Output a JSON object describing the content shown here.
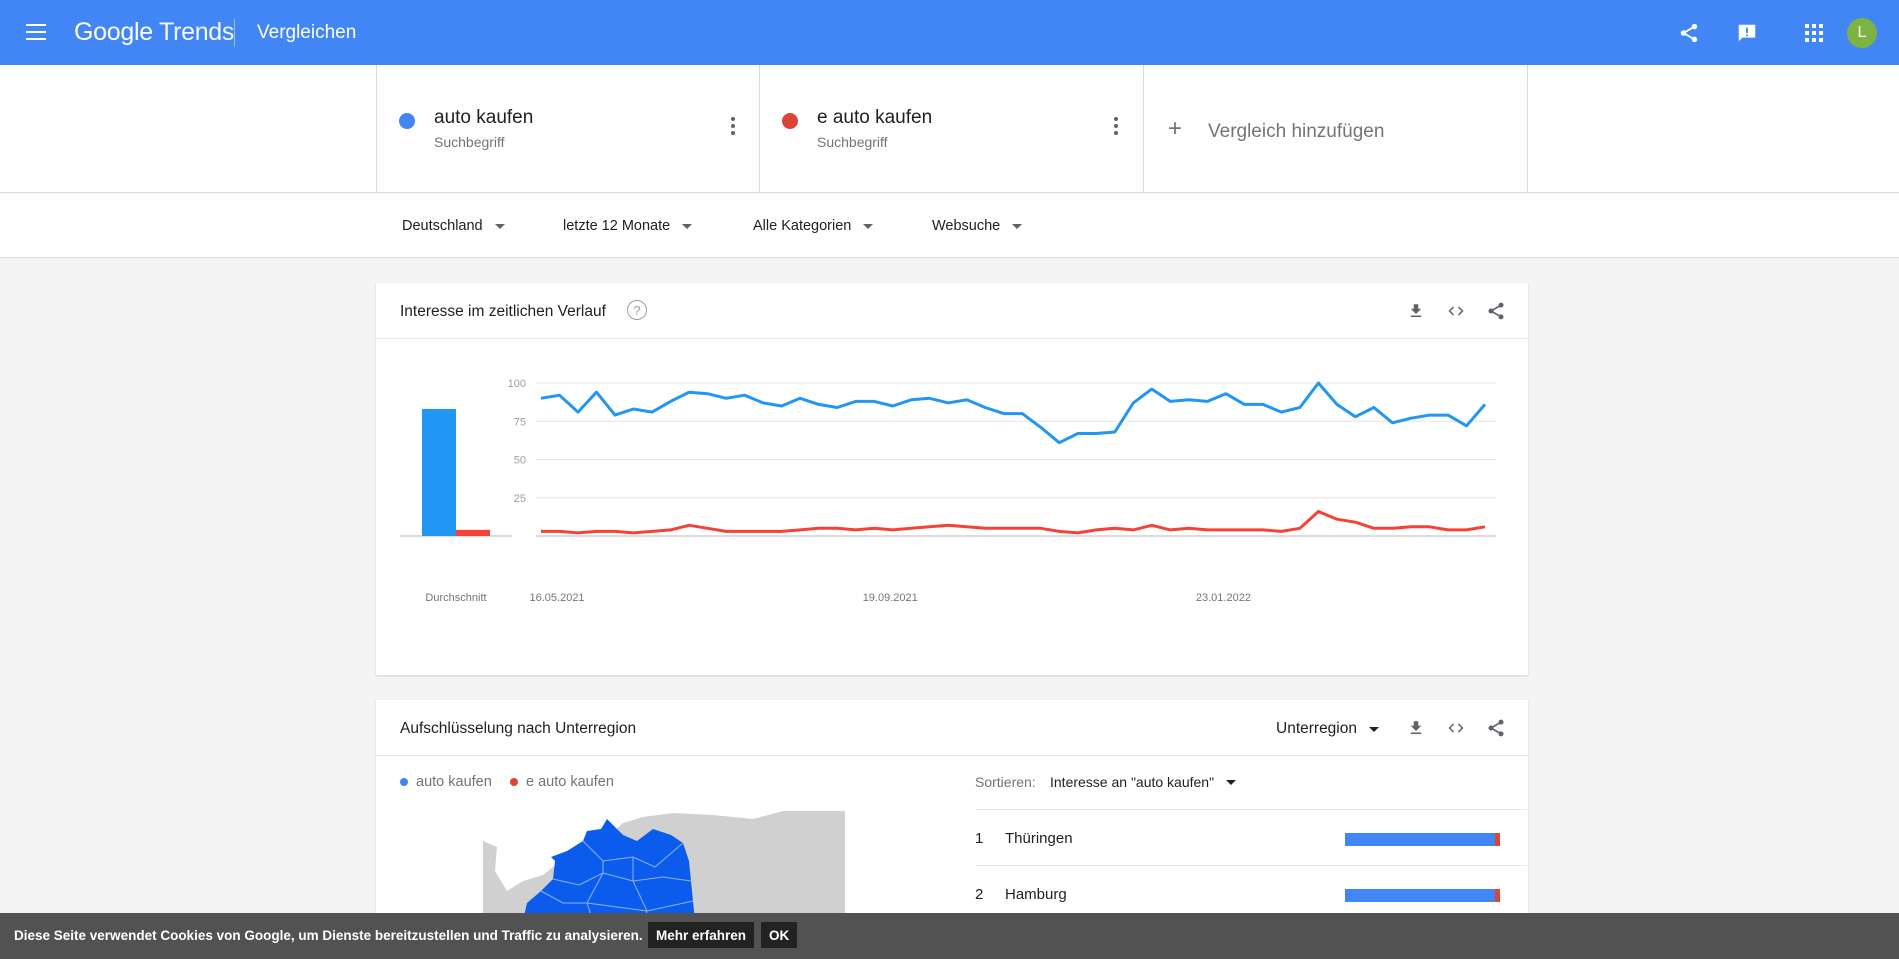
{
  "header": {
    "logo_google": "Google",
    "logo_trends": "Trends",
    "title": "Vergleichen",
    "avatar_letter": "L",
    "icons": [
      "share-icon",
      "feedback-icon",
      "apps-icon"
    ]
  },
  "terms": [
    {
      "name": "auto kaufen",
      "type": "Suchbegriff",
      "color": "#4285f4"
    },
    {
      "name": "e auto kaufen",
      "type": "Suchbegriff",
      "color": "#db4437"
    }
  ],
  "add_compare": {
    "label": "Vergleich hinzufügen"
  },
  "filters": {
    "region": "Deutschland",
    "time": "letzte 12 Monate",
    "category": "Alle Kategorien",
    "search_type": "Websuche"
  },
  "interest_over_time": {
    "title": "Interesse im zeitlichen Verlauf",
    "help": "?",
    "average_label": "Durchschnitt"
  },
  "chart_data": {
    "type": "line",
    "title": "Interesse im zeitlichen Verlauf",
    "x_tick_labels": [
      "16.05.2021",
      "19.09.2021",
      "23.01.2022"
    ],
    "x_tick_index": [
      1,
      19,
      37
    ],
    "ylim": [
      0,
      100
    ],
    "y_ticks": [
      100,
      75,
      50,
      25
    ],
    "grid": true,
    "series": [
      {
        "name": "auto kaufen",
        "color": "#2196f3",
        "average": 83,
        "values": [
          90,
          92,
          81,
          94,
          79,
          83,
          81,
          88,
          94,
          93,
          90,
          92,
          87,
          85,
          90,
          86,
          84,
          88,
          88,
          85,
          89,
          90,
          87,
          89,
          84,
          80,
          80,
          71,
          61,
          67,
          67,
          68,
          87,
          96,
          88,
          89,
          88,
          93,
          86,
          86,
          81,
          84,
          100,
          86,
          78,
          84,
          74,
          77,
          79,
          79,
          72,
          86
        ]
      },
      {
        "name": "e auto kaufen",
        "color": "#f44336",
        "average": 4,
        "values": [
          3,
          3,
          2,
          3,
          3,
          2,
          3,
          4,
          7,
          5,
          3,
          3,
          3,
          3,
          4,
          5,
          5,
          4,
          5,
          4,
          5,
          6,
          7,
          6,
          5,
          5,
          5,
          5,
          3,
          2,
          4,
          5,
          4,
          7,
          4,
          5,
          4,
          4,
          4,
          4,
          3,
          5,
          16,
          11,
          9,
          5,
          5,
          6,
          6,
          4,
          4,
          6
        ]
      }
    ]
  },
  "subregion": {
    "title": "Aufschlüsselung nach Unterregion",
    "dropdown": "Unterregion",
    "sort_label": "Sortieren:",
    "sort_value": "Interesse an \"auto kaufen\"",
    "rows": [
      {
        "rank": "1",
        "name": "Thüringen",
        "share_a": 97,
        "share_b": 3
      },
      {
        "rank": "2",
        "name": "Hamburg",
        "share_a": 97,
        "share_b": 3
      }
    ]
  },
  "cookie": {
    "text": "Diese Seite verwendet Cookies von Google, um Dienste bereitzustellen und Traffic zu analysieren.",
    "more": "Mehr erfahren",
    "ok": "OK"
  }
}
